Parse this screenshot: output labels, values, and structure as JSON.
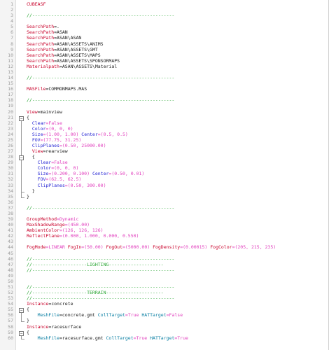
{
  "lines": [
    {
      "n": "1",
      "segs": [
        {
          "t": "CUBEASF",
          "c": "t-red"
        }
      ]
    },
    {
      "n": "2",
      "segs": []
    },
    {
      "n": "3",
      "segs": [
        {
          "t": "//----------------------------------------------------",
          "c": "t-grn"
        }
      ]
    },
    {
      "n": "4",
      "segs": []
    },
    {
      "n": "5",
      "segs": [
        {
          "t": "SearchPath",
          "c": "t-red"
        },
        {
          "t": "=.",
          "c": "t-blk"
        }
      ]
    },
    {
      "n": "6",
      "segs": [
        {
          "t": "SearchPath",
          "c": "t-red"
        },
        {
          "t": "=ASAN",
          "c": "t-blk"
        }
      ]
    },
    {
      "n": "7",
      "segs": [
        {
          "t": "SearchPath",
          "c": "t-red"
        },
        {
          "t": "=ASAN\\ASAN",
          "c": "t-blk"
        }
      ]
    },
    {
      "n": "8",
      "segs": [
        {
          "t": "SearchPath",
          "c": "t-red"
        },
        {
          "t": "=ASAN\\ASSETS\\ANIMS",
          "c": "t-blk"
        }
      ]
    },
    {
      "n": "9",
      "segs": [
        {
          "t": "SearchPath",
          "c": "t-red"
        },
        {
          "t": "=ASAN\\ASSETS\\GMT",
          "c": "t-blk"
        }
      ]
    },
    {
      "n": "10",
      "segs": [
        {
          "t": "SearchPath",
          "c": "t-red"
        },
        {
          "t": "=ASAN\\ASSETS\\MAPS",
          "c": "t-blk"
        }
      ]
    },
    {
      "n": "11",
      "segs": [
        {
          "t": "SearchPath",
          "c": "t-red"
        },
        {
          "t": "=ASAN\\ASSETS\\SPONSORMAPS",
          "c": "t-blk"
        }
      ]
    },
    {
      "n": "12",
      "segs": [
        {
          "t": "Materialpath",
          "c": "t-red"
        },
        {
          "t": "=ASAN\\ASSETS\\Material",
          "c": "t-blk"
        }
      ]
    },
    {
      "n": "13",
      "segs": []
    },
    {
      "n": "14",
      "segs": [
        {
          "t": "//----------------------------------------------------",
          "c": "t-grn"
        }
      ]
    },
    {
      "n": "15",
      "segs": []
    },
    {
      "n": "16",
      "segs": [
        {
          "t": "MASFile",
          "c": "t-red"
        },
        {
          "t": "=COMMONMAPS.MAS",
          "c": "t-blk"
        }
      ]
    },
    {
      "n": "17",
      "segs": []
    },
    {
      "n": "18",
      "segs": [
        {
          "t": "//----------------------------------------------------",
          "c": "t-grn"
        }
      ]
    },
    {
      "n": "19",
      "segs": []
    },
    {
      "n": "20",
      "segs": [
        {
          "t": "View",
          "c": "t-red"
        },
        {
          "t": "=mainview",
          "c": "t-blk"
        }
      ]
    },
    {
      "n": "21",
      "segs": [
        {
          "t": "{",
          "c": "t-blk"
        }
      ]
    },
    {
      "n": "22",
      "segs": [
        {
          "t": "  Clear",
          "c": "t-blu"
        },
        {
          "t": "=False",
          "c": "t-mag"
        }
      ]
    },
    {
      "n": "23",
      "segs": [
        {
          "t": "  Color",
          "c": "t-blu"
        },
        {
          "t": "=(0, 0, 0)",
          "c": "t-mag"
        }
      ]
    },
    {
      "n": "24",
      "segs": [
        {
          "t": "  Size",
          "c": "t-blu"
        },
        {
          "t": "=(1.00, 1.00) ",
          "c": "t-mag"
        },
        {
          "t": "Center",
          "c": "t-blu"
        },
        {
          "t": "=(0.5, 0.5)",
          "c": "t-mag"
        }
      ]
    },
    {
      "n": "25",
      "segs": [
        {
          "t": "  FOV",
          "c": "t-blu"
        },
        {
          "t": "=(77.75, 31.25)",
          "c": "t-mag"
        }
      ]
    },
    {
      "n": "26",
      "segs": [
        {
          "t": "  ClipPlanes",
          "c": "t-blu"
        },
        {
          "t": "=(0.50, 25000.00)",
          "c": "t-mag"
        }
      ]
    },
    {
      "n": "27",
      "segs": [
        {
          "t": "  View",
          "c": "t-red"
        },
        {
          "t": "=rearview",
          "c": "t-blk"
        }
      ]
    },
    {
      "n": "28",
      "segs": [
        {
          "t": "  {",
          "c": "t-blk"
        }
      ]
    },
    {
      "n": "29",
      "segs": [
        {
          "t": "    Clear",
          "c": "t-blu"
        },
        {
          "t": "=False",
          "c": "t-mag"
        }
      ]
    },
    {
      "n": "30",
      "segs": [
        {
          "t": "    Color",
          "c": "t-blu"
        },
        {
          "t": "=(0, 0, 0)",
          "c": "t-mag"
        }
      ]
    },
    {
      "n": "31",
      "segs": [
        {
          "t": "    Size",
          "c": "t-blu"
        },
        {
          "t": "=(0.200, 0.100) ",
          "c": "t-mag"
        },
        {
          "t": "Center",
          "c": "t-blu"
        },
        {
          "t": "=(0.50, 0.01)",
          "c": "t-mag"
        }
      ]
    },
    {
      "n": "32",
      "segs": [
        {
          "t": "    FOV",
          "c": "t-blu"
        },
        {
          "t": "=(62.5, 62.5)",
          "c": "t-mag"
        }
      ]
    },
    {
      "n": "33",
      "segs": [
        {
          "t": "    ClipPlanes",
          "c": "t-blu"
        },
        {
          "t": "=(0.50, 300.00)",
          "c": "t-mag"
        }
      ]
    },
    {
      "n": "34",
      "segs": [
        {
          "t": "  }",
          "c": "t-blk"
        }
      ]
    },
    {
      "n": "35",
      "segs": [
        {
          "t": "}",
          "c": "t-blk"
        }
      ]
    },
    {
      "n": "36",
      "segs": []
    },
    {
      "n": "37",
      "segs": [
        {
          "t": "//----------------------------------------------------",
          "c": "t-grn"
        }
      ]
    },
    {
      "n": "38",
      "segs": []
    },
    {
      "n": "39",
      "segs": [
        {
          "t": "GroupMethod",
          "c": "t-red"
        },
        {
          "t": "=Dynamic",
          "c": "t-mag"
        }
      ]
    },
    {
      "n": "40",
      "segs": [
        {
          "t": "MaxShadowRange",
          "c": "t-red"
        },
        {
          "t": "=(450.00)",
          "c": "t-mag"
        }
      ]
    },
    {
      "n": "41",
      "segs": [
        {
          "t": "AmbientColor",
          "c": "t-red"
        },
        {
          "t": "=(126, 126, 126)",
          "c": "t-mag"
        }
      ]
    },
    {
      "n": "42",
      "segs": [
        {
          "t": "ReflectPlane",
          "c": "t-red"
        },
        {
          "t": "=(0.000, 1.000, 0.000, 0.550)",
          "c": "t-mag"
        }
      ]
    },
    {
      "n": "43",
      "segs": []
    },
    {
      "n": "44",
      "segs": [
        {
          "t": "FogMode",
          "c": "t-red"
        },
        {
          "t": "=LINEAR ",
          "c": "t-mag"
        },
        {
          "t": "FogIn",
          "c": "t-red"
        },
        {
          "t": "=(50.00) ",
          "c": "t-mag"
        },
        {
          "t": "FogOut",
          "c": "t-red"
        },
        {
          "t": "=(5000.00) ",
          "c": "t-mag"
        },
        {
          "t": "FogDensity",
          "c": "t-red"
        },
        {
          "t": "=(0.00015) ",
          "c": "t-mag"
        },
        {
          "t": "FogColor",
          "c": "t-red"
        },
        {
          "t": "=(205, 215, 235)",
          "c": "t-mag"
        }
      ]
    },
    {
      "n": "45",
      "segs": []
    },
    {
      "n": "46",
      "segs": [
        {
          "t": "//----------------------------------------------------",
          "c": "t-grn"
        }
      ]
    },
    {
      "n": "47",
      "segs": [
        {
          "t": "//--------------------LIGHTING--------------------",
          "c": "t-grn"
        }
      ]
    },
    {
      "n": "48",
      "segs": [
        {
          "t": "//----------------------------------------------------",
          "c": "t-grn"
        }
      ]
    },
    {
      "n": "49",
      "segs": []
    },
    {
      "n": "50",
      "segs": []
    },
    {
      "n": "51",
      "segs": [
        {
          "t": "//----------------------------------------------------",
          "c": "t-grn"
        }
      ]
    },
    {
      "n": "52",
      "segs": [
        {
          "t": "//--------------------TERRAIN---------------------",
          "c": "t-grn"
        }
      ]
    },
    {
      "n": "53",
      "segs": [
        {
          "t": "//----------------------------------------------------",
          "c": "t-grn"
        }
      ]
    },
    {
      "n": "54",
      "segs": [
        {
          "t": "Instance",
          "c": "t-red"
        },
        {
          "t": "=concrete",
          "c": "t-blk"
        }
      ]
    },
    {
      "n": "55",
      "segs": [
        {
          "t": "{",
          "c": "t-blk"
        }
      ]
    },
    {
      "n": "56",
      "segs": [
        {
          "t": "    MeshFile",
          "c": "t-teal"
        },
        {
          "t": "=concrete.gmt ",
          "c": "t-blk"
        },
        {
          "t": "CollTarget",
          "c": "t-teal"
        },
        {
          "t": "=True ",
          "c": "t-mag"
        },
        {
          "t": "HATTarget",
          "c": "t-teal"
        },
        {
          "t": "=False",
          "c": "t-mag"
        }
      ]
    },
    {
      "n": "57",
      "segs": [
        {
          "t": "}",
          "c": "t-blk"
        }
      ]
    },
    {
      "n": "58",
      "segs": [
        {
          "t": "Instance",
          "c": "t-red"
        },
        {
          "t": "=racesurface",
          "c": "t-blk"
        }
      ]
    },
    {
      "n": "59",
      "segs": [
        {
          "t": "{",
          "c": "t-blk"
        }
      ]
    },
    {
      "n": "60",
      "segs": [
        {
          "t": "    MeshFile",
          "c": "t-teal"
        },
        {
          "t": "=racesurface.gmt ",
          "c": "t-blk"
        },
        {
          "t": "CollTarget",
          "c": "t-teal"
        },
        {
          "t": "=True ",
          "c": "t-mag"
        },
        {
          "t": "HATTarget",
          "c": "t-teal"
        },
        {
          "t": "=True",
          "c": "t-mag"
        }
      ]
    }
  ],
  "folds": [
    {
      "start": "21",
      "end": "35",
      "icon": "minus-icon"
    },
    {
      "start": "28",
      "end": "34",
      "icon": "minus-icon"
    },
    {
      "start": "55",
      "end": "57",
      "icon": "minus-icon"
    },
    {
      "start": "59",
      "end": "60",
      "icon": "minus-icon"
    }
  ]
}
